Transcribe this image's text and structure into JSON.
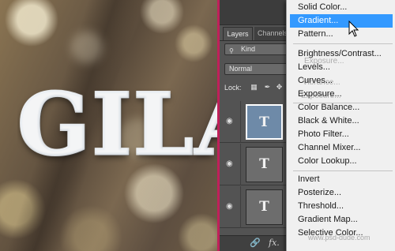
{
  "canvas": {
    "text": "GILA"
  },
  "panel": {
    "tabs": [
      "Layers",
      "Channels"
    ],
    "filter_icon": "search-icon",
    "filter_value": "Kind",
    "blend_mode": "Normal",
    "lock_label": "Lock:",
    "layers": [
      {
        "thumb": "T",
        "selected": true
      },
      {
        "thumb": "T",
        "selected": false
      },
      {
        "thumb": "T",
        "selected": false
      }
    ],
    "bottom_icons": [
      "link-icon",
      "fx-icon",
      "mask-icon",
      "adjustment-icon"
    ],
    "fx_label": "fx."
  },
  "menu": {
    "groups": [
      [
        "Solid Color...",
        "Gradient...",
        "Pattern..."
      ],
      [
        "Brightness/Contrast...",
        "Levels...",
        "Curves...",
        "Exposure..."
      ],
      [
        "Color Balance...",
        "Black & White...",
        "Photo Filter...",
        "Channel Mixer...",
        "Color Lookup..."
      ],
      [
        "Invert",
        "Posterize...",
        "Threshold...",
        "Gradient Map...",
        "Selective Color..."
      ]
    ],
    "highlighted": "Gradient...",
    "ghost_text": [
      "Exposure...",
      "Vibrance...",
      "Exposure..."
    ]
  },
  "watermark": "www.psd-dude.com",
  "colors": {
    "menu_highlight": "#3399ff",
    "selected_layer": "#6e8aa8",
    "canvas_edge": "#c0205a"
  }
}
